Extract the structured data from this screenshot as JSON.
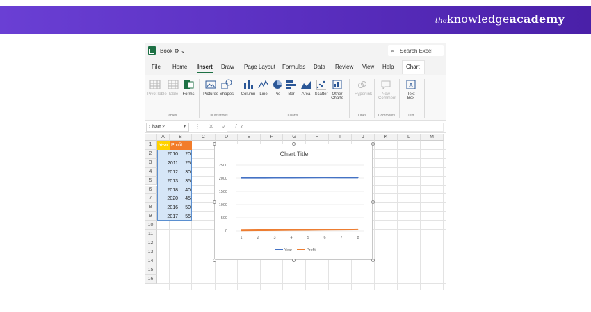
{
  "brand": {
    "prefix": "the",
    "word1": "knowledge",
    "word2": "academy"
  },
  "titlebar": {
    "book": "Book",
    "search_placeholder": "Search Excel"
  },
  "tabs": [
    "File",
    "Home",
    "Insert",
    "Draw",
    "Page Layout",
    "Formulas",
    "Data",
    "Review",
    "View",
    "Help",
    "Chart"
  ],
  "active_tab": "Insert",
  "ribbon": {
    "tables": {
      "label": "Tables",
      "buttons": [
        "PivotTable",
        "Table",
        "Forms"
      ]
    },
    "illustrations": {
      "label": "Illustrations",
      "buttons": [
        "Pictures",
        "Shapes"
      ]
    },
    "charts": {
      "label": "Charts",
      "buttons": [
        "Column",
        "Line",
        "Pie",
        "Bar",
        "Area",
        "Scatter",
        "Other Charts"
      ]
    },
    "links": {
      "label": "Links",
      "buttons": [
        "Hyperlink"
      ]
    },
    "comments": {
      "label": "Comments",
      "buttons": [
        "New Comment"
      ]
    },
    "text": {
      "label": "Text",
      "buttons": [
        "Text Box"
      ]
    }
  },
  "formula_bar": {
    "name_box": "Chart 2",
    "fx": "fx"
  },
  "columns": [
    "A",
    "B",
    "C",
    "D",
    "E",
    "F",
    "G",
    "H",
    "I",
    "J",
    "K",
    "L",
    "M"
  ],
  "rows": [
    "1",
    "2",
    "3",
    "4",
    "5",
    "6",
    "7",
    "8",
    "9",
    "10",
    "11",
    "12",
    "13",
    "14",
    "15",
    "16"
  ],
  "sheet": {
    "headers": [
      "Year",
      "Profit"
    ],
    "data": [
      [
        "2010",
        "20"
      ],
      [
        "2011",
        "25"
      ],
      [
        "2012",
        "30"
      ],
      [
        "2013",
        "35"
      ],
      [
        "2018",
        "40"
      ],
      [
        "2020",
        "45"
      ],
      [
        "2016",
        "50"
      ],
      [
        "2017",
        "55"
      ]
    ]
  },
  "colors": {
    "year_header": "#ffd200",
    "profit_header": "#f27c2a",
    "year_line": "#4472c4",
    "profit_line": "#ed7d31",
    "selection": "#d6e6f7"
  },
  "chart_data": {
    "type": "line",
    "title": "Chart Title",
    "categories": [
      "1",
      "2",
      "3",
      "4",
      "5",
      "6",
      "7",
      "8"
    ],
    "series": [
      {
        "name": "Year",
        "values": [
          2010,
          2011,
          2012,
          2013,
          2018,
          2020,
          2016,
          2017
        ]
      },
      {
        "name": "Profit",
        "values": [
          20,
          25,
          30,
          35,
          40,
          45,
          50,
          55
        ]
      }
    ],
    "ylim": [
      0,
      2500
    ],
    "yticks": [
      "0",
      "500",
      "1000",
      "1500",
      "2000",
      "2500"
    ],
    "legend": "bottom",
    "grid": true
  }
}
